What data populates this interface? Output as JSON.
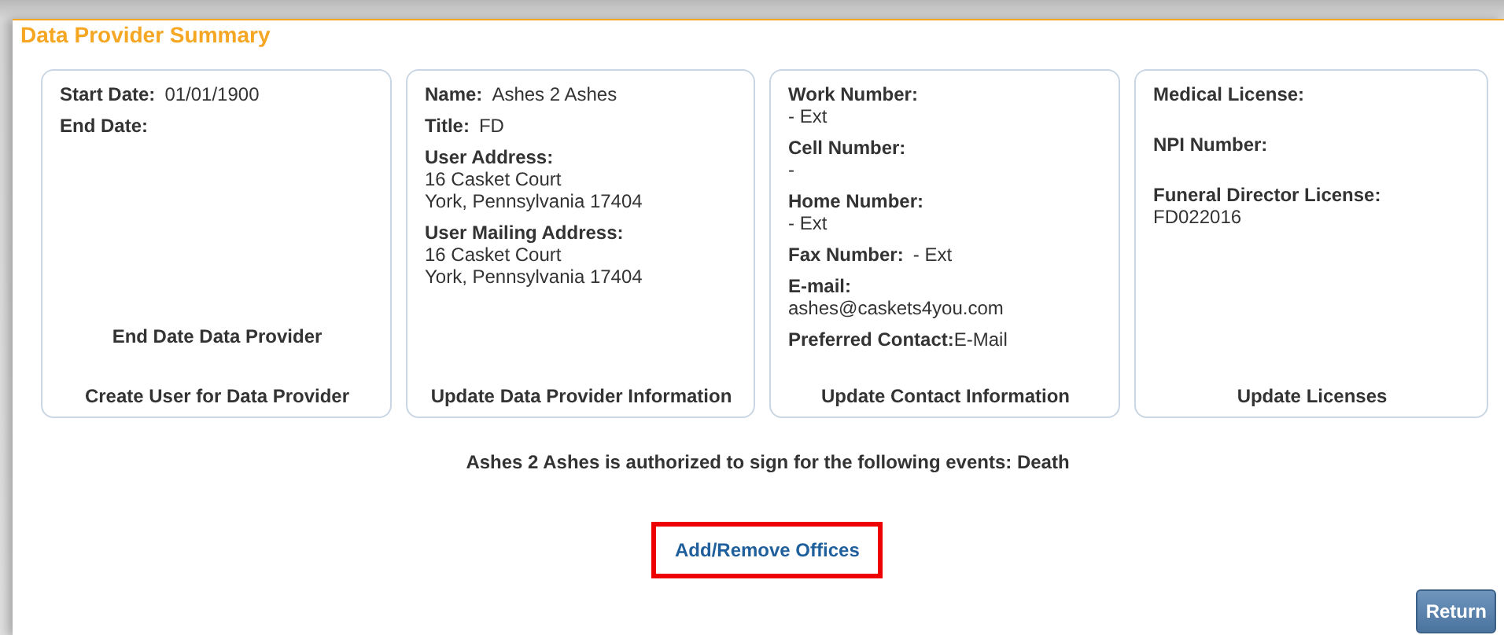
{
  "title": "Data Provider Summary",
  "cards": [
    {
      "fields": [
        {
          "kind": "inline",
          "label": "Start Date:",
          "value": "01/01/1900"
        },
        {
          "kind": "label",
          "label": "End Date:"
        }
      ],
      "actions": [
        "End Date Data Provider",
        "Create User for Data Provider"
      ]
    },
    {
      "fields": [
        {
          "kind": "inline",
          "label": "Name:",
          "value": "Ashes 2 Ashes"
        },
        {
          "kind": "inline",
          "label": "Title:",
          "value": "FD"
        },
        {
          "kind": "stacked",
          "label": "User Address:",
          "lines": [
            "16 Casket Court",
            "York, Pennsylvania 17404"
          ]
        },
        {
          "kind": "stacked",
          "label": "User Mailing Address:",
          "lines": [
            "16 Casket Court",
            "York, Pennsylvania 17404"
          ]
        }
      ],
      "actions": [
        "Update Data Provider Information"
      ]
    },
    {
      "fields": [
        {
          "kind": "stacked",
          "label": "Work Number:",
          "lines": [
            "- Ext"
          ]
        },
        {
          "kind": "stacked",
          "label": "Cell Number:",
          "lines": [
            "-"
          ]
        },
        {
          "kind": "stacked",
          "label": "Home Number:",
          "lines": [
            "- Ext"
          ]
        },
        {
          "kind": "inline",
          "label": "Fax Number:",
          "value": "- Ext"
        },
        {
          "kind": "stacked",
          "label": "E-mail:",
          "lines": [
            "ashes@caskets4you.com"
          ]
        },
        {
          "kind": "tight",
          "label": "Preferred Contact:",
          "value": "E-Mail"
        }
      ],
      "actions": [
        "Update Contact Information"
      ]
    },
    {
      "fields": [
        {
          "kind": "label",
          "label": "Medical License:"
        },
        {
          "kind": "label",
          "label": "NPI Number:"
        },
        {
          "kind": "stacked",
          "label": "Funeral Director License:",
          "lines": [
            "FD022016"
          ]
        }
      ],
      "actions": [
        "Update Licenses"
      ]
    }
  ],
  "authorization": "Ashes 2 Ashes is authorized to sign for the following events: Death",
  "offices_link": {
    "label": "Add/Remove Offices",
    "highlighted": true
  },
  "return_button": "Return"
}
